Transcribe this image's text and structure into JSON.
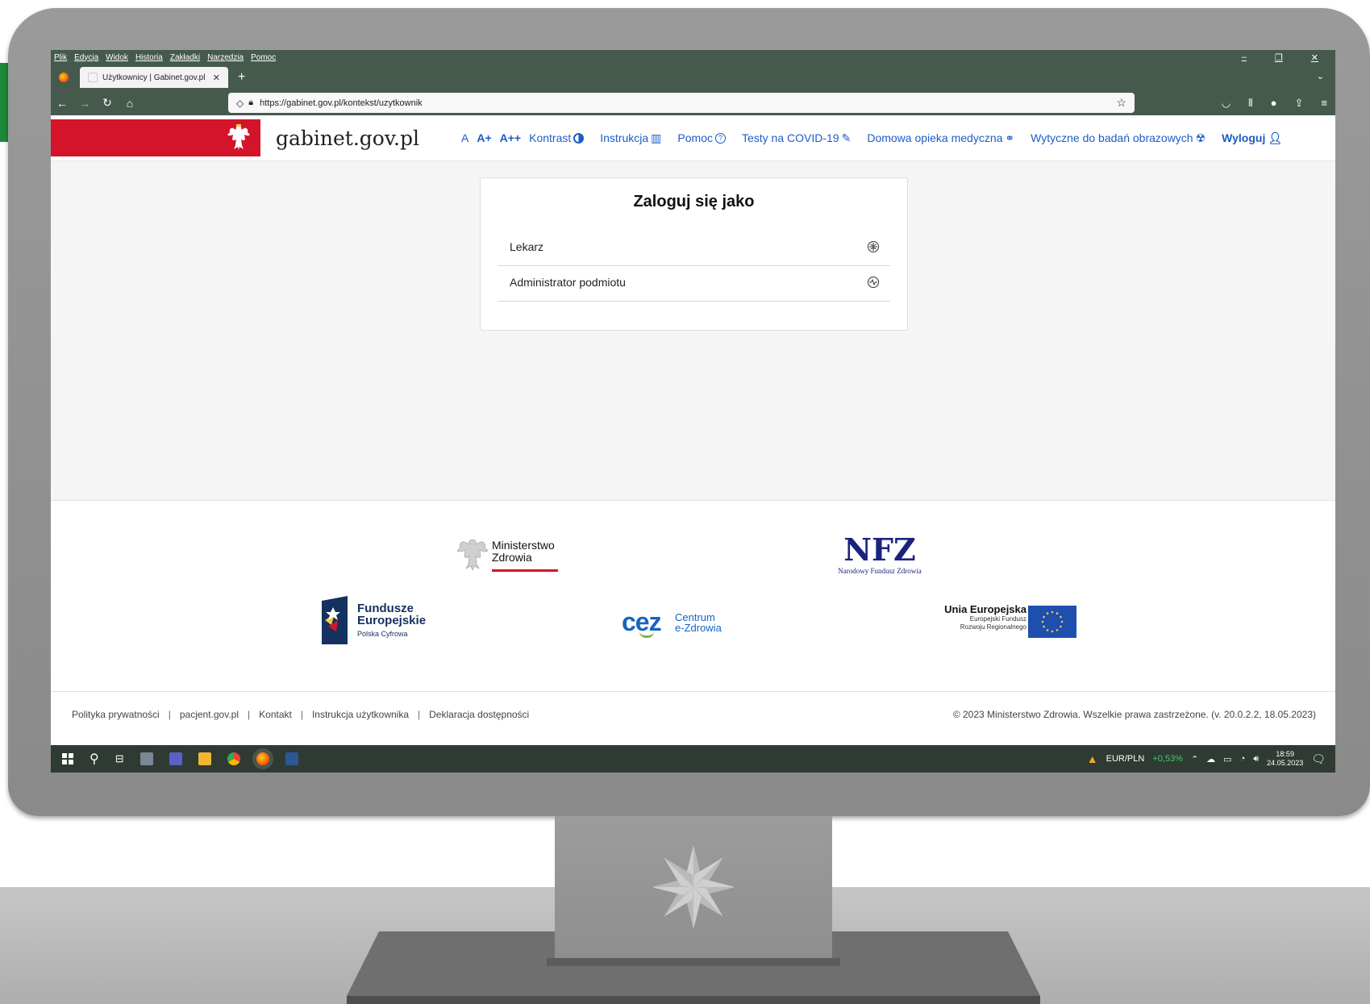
{
  "browser": {
    "menu": [
      "Plik",
      "Edycja",
      "Widok",
      "Historia",
      "Zakładki",
      "Narzędzia",
      "Pomoc"
    ],
    "tab_title": "Użytkownicy | Gabinet.gov.pl",
    "url": "https://gabinet.gov.pl/kontekst/uzytkownik"
  },
  "site": {
    "brand": "gabinet.gov.pl",
    "nav": {
      "font_a": "A",
      "font_a_plus": "A+",
      "font_a_plus_plus": "A++",
      "contrast": "Kontrast",
      "manual": "Instrukcja",
      "help": "Pomoc",
      "covid": "Testy na COVID-19",
      "home_care": "Domowa opieka medyczna",
      "imaging": "Wytyczne do badań obrazowych",
      "logout": "Wyloguj"
    }
  },
  "login": {
    "title": "Zaloguj się jako",
    "roles": [
      {
        "label": "Lekarz",
        "icon": "globe-icon"
      },
      {
        "label": "Administrator podmiotu",
        "icon": "pulse-icon"
      }
    ]
  },
  "partners": {
    "mz": {
      "line1": "Ministerstwo",
      "line2": "Zdrowia"
    },
    "nfz": {
      "title": "NFZ",
      "subtitle": "Narodowy Fundusz Zdrowia"
    },
    "fe": {
      "line1": "Fundusze",
      "line2": "Europejskie",
      "line3": "Polska Cyfrowa"
    },
    "cez": {
      "mark": "cez",
      "line1": "Centrum",
      "line2": "e-Zdrowia"
    },
    "ue": {
      "line1": "Unia Europejska",
      "line2": "Europejski Fundusz",
      "line3": "Rozwoju Regionalnego"
    }
  },
  "footer": {
    "links": [
      "Polityka prywatności",
      "pacjent.gov.pl",
      "Kontakt",
      "Instrukcja użytkownika",
      "Deklaracja dostępności"
    ],
    "copyright": "© 2023 Ministerstwo Zdrowia. Wszelkie prawa zastrzeżone.  (v. 20.0.2.2, 18.05.2023)"
  },
  "taskbar": {
    "ticker": "EUR/PLN",
    "ticker_change": "+0,53%",
    "time": "18:59",
    "date": "24.05.2023"
  },
  "colors": {
    "browser_chrome": "#455a4d",
    "gov_red": "#d4142a",
    "link_blue": "#1d5cc7",
    "nfz_navy": "#1a237e",
    "cez_blue": "#1565c0",
    "cez_green": "#7cb342"
  }
}
